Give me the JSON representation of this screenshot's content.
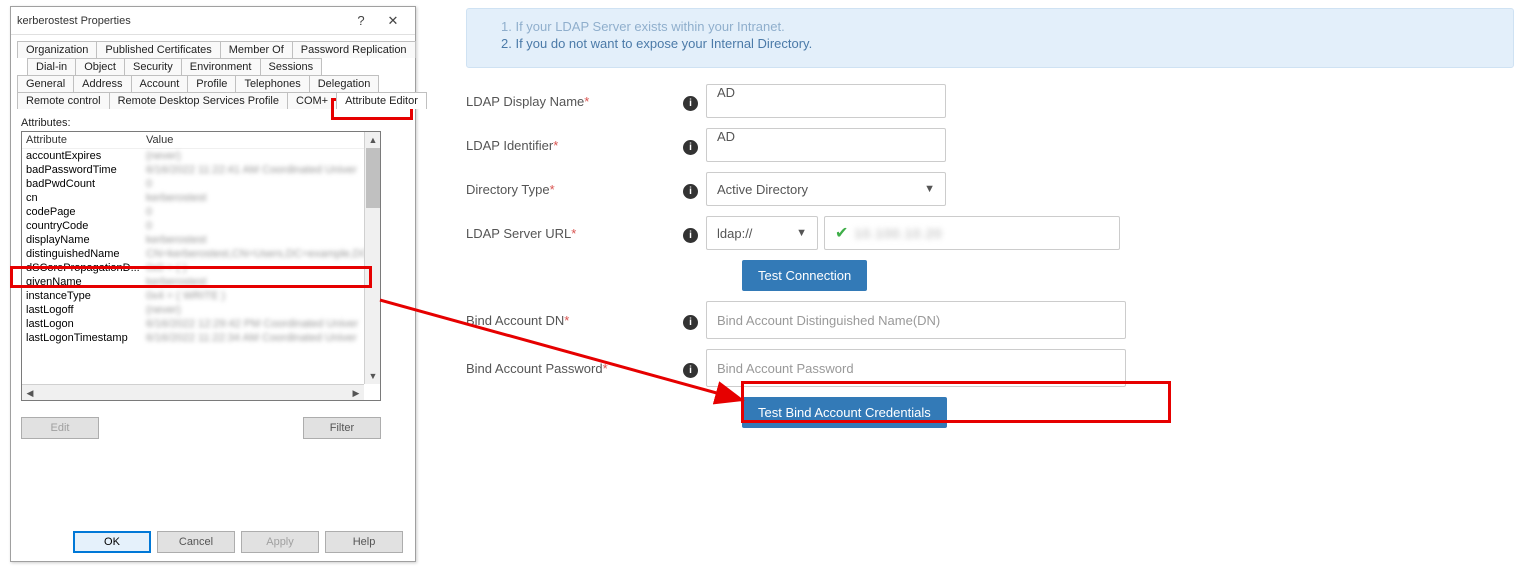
{
  "dialog": {
    "title": "kerberostest Properties",
    "help": "?",
    "close": "✕",
    "tabs_row1": [
      "Organization",
      "Published Certificates",
      "Member Of",
      "Password Replication"
    ],
    "tabs_row2": [
      "Dial-in",
      "Object",
      "Security",
      "Environment",
      "Sessions"
    ],
    "tabs_row3": [
      "General",
      "Address",
      "Account",
      "Profile",
      "Telephones",
      "Delegation"
    ],
    "tabs_row4": [
      "Remote control",
      "Remote Desktop Services Profile",
      "COM+",
      "Attribute Editor"
    ],
    "active_tab": "Attribute Editor",
    "attributes_label": "Attributes:",
    "header_col1": "Attribute",
    "header_col2": "Value",
    "rows": [
      {
        "name": "accountExpires",
        "value": "(never)"
      },
      {
        "name": "badPasswordTime",
        "value": "6/16/2022 11:22:41 AM Coordinated Univer"
      },
      {
        "name": "badPwdCount",
        "value": "0"
      },
      {
        "name": "cn",
        "value": "kerberostest"
      },
      {
        "name": "codePage",
        "value": "0"
      },
      {
        "name": "countryCode",
        "value": "0"
      },
      {
        "name": "displayName",
        "value": "kerberostest"
      },
      {
        "name": "distinguishedName",
        "value": "CN=kerberostest,CN=Users,DC=example,DC"
      },
      {
        "name": "dSCorePropagationD...",
        "value": "0x0 = ( )"
      },
      {
        "name": "givenName",
        "value": "kerberostest"
      },
      {
        "name": "instanceType",
        "value": "0x4 = ( WRITE )"
      },
      {
        "name": "lastLogoff",
        "value": "(never)"
      },
      {
        "name": "lastLogon",
        "value": "6/16/2022 12:29:42 PM Coordinated Univer"
      },
      {
        "name": "lastLogonTimestamp",
        "value": "6/16/2022 11:22:34 AM Coordinated Univer"
      }
    ],
    "edit_btn": "Edit",
    "filter_btn": "Filter",
    "ok": "OK",
    "cancel": "Cancel",
    "apply": "Apply",
    "help_btn": "Help"
  },
  "info": {
    "line0": "1. If your LDAP Server exists within your Intranet.",
    "line1": "2. If you do not want to expose your Internal Directory."
  },
  "form": {
    "display_name_label": "LDAP Display Name",
    "display_name_value": "AD",
    "identifier_label": "LDAP Identifier",
    "identifier_value": "AD",
    "dir_type_label": "Directory Type",
    "dir_type_value": "Active Directory",
    "server_url_label": "LDAP Server URL",
    "protocol_value": "ldap://",
    "server_host_blur": "10.100.10.20",
    "test_conn": "Test Connection",
    "bind_dn_label": "Bind Account DN",
    "bind_dn_placeholder": "Bind Account Distinguished Name(DN)",
    "bind_pw_label": "Bind Account Password",
    "bind_pw_placeholder": "Bind Account Password",
    "test_bind": "Test Bind Account Credentials"
  }
}
